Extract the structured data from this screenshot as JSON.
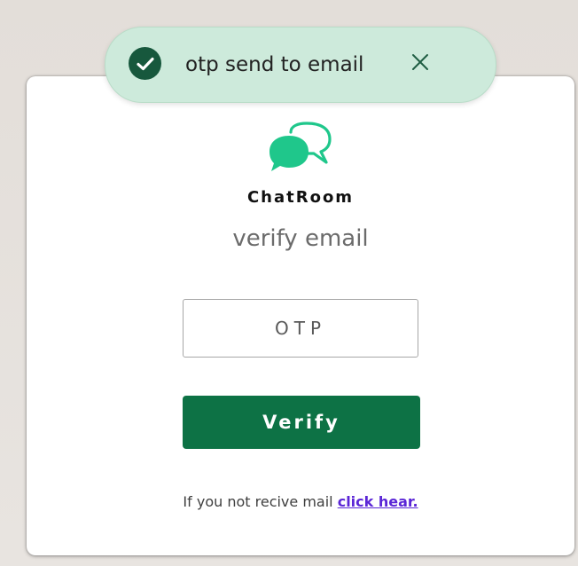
{
  "toast": {
    "message": "otp send to email",
    "status_icon": "check-circle-icon",
    "close_icon": "close-icon",
    "accent_color": "#17583d"
  },
  "brand": {
    "logo_icon": "chat-bubbles-icon",
    "name": "ChatRoom"
  },
  "form": {
    "subtitle": "verify email",
    "otp_placeholder": "OTP",
    "otp_value": "",
    "verify_label": "Verify",
    "button_color": "#0d7245"
  },
  "footer": {
    "prompt": "If you not recive mail ",
    "link_label": "click hear."
  }
}
